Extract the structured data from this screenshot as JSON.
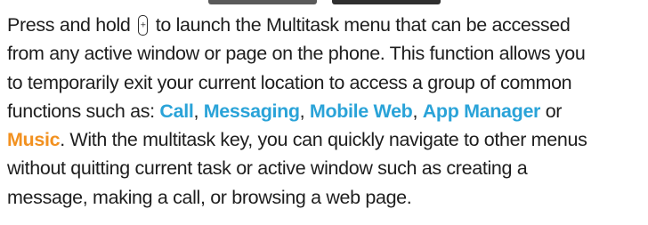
{
  "paragraph": {
    "line1_before_key": "Press and hold ",
    "key_icon": "multitask-key-icon",
    "line1_after_key": " to launch the Multitask menu that can be accessed",
    "line2": "from any active window or page on the phone. This function allows you",
    "line3": "to temporarily exit your current location to access a group of common",
    "line4_before": "functions such as: ",
    "call": "Call",
    "sep1": ", ",
    "messaging": "Messaging",
    "sep2": ", ",
    "mobile_web": "Mobile Web",
    "sep3": ", ",
    "app_manager": "App Manager",
    "line4_after": " or",
    "music": "Music",
    "line5_after": ". With the multitask key, you can quickly navigate to other menus",
    "line6": "without quitting current task or active window such as creating a",
    "line7": "message, making a call, or browsing a web page."
  },
  "colors": {
    "text": "#1e1e1e",
    "highlight_blue": "#2aa3d8",
    "highlight_orange": "#f29120"
  }
}
